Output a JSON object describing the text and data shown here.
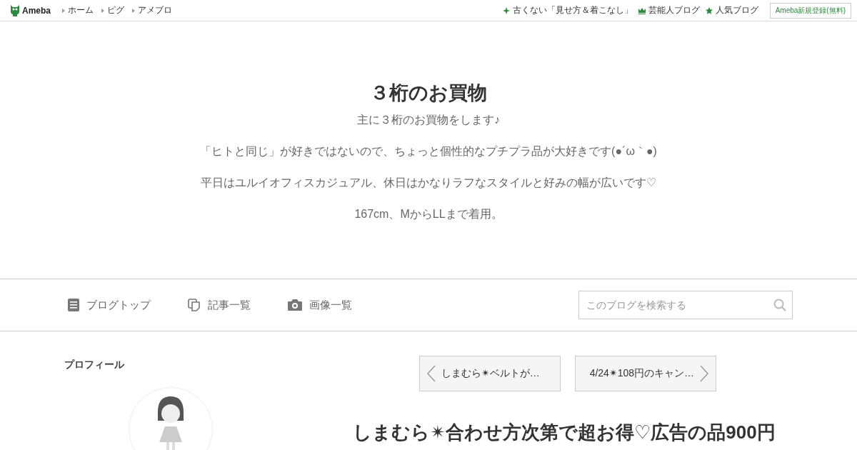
{
  "header": {
    "logo": "Ameba",
    "links": [
      "ホーム",
      "ピグ",
      "アメブロ"
    ],
    "promo_links": [
      {
        "kind": "sparkle",
        "label": "古くない「見せ方＆着こなし」"
      },
      {
        "kind": "crown",
        "label": "芸能人ブログ"
      },
      {
        "kind": "star",
        "label": "人気ブログ"
      }
    ],
    "signup_button": "Ameba新規登録(無料)"
  },
  "blog": {
    "title": "３桁のお買物",
    "description": [
      "主に３桁のお買物をします♪",
      "「ヒトと同じ」が好きではないので、ちょっと個性的なプチプラ品が大好きです(●´ω｀●)",
      "平日はユルイオフィスカジュアル、休日はかなりラフなスタイルと好みの幅が広いです♡",
      "167cm、MからLLまで着用。"
    ]
  },
  "blog_nav": {
    "items": [
      {
        "kind": "document",
        "label": "ブログトップ"
      },
      {
        "kind": "copy",
        "label": "記事一覧"
      },
      {
        "kind": "camera",
        "label": "画像一覧"
      }
    ],
    "search": {
      "placeholder": "このブログを検索する"
    }
  },
  "sidebar": {
    "heading": "プロフィール"
  },
  "article": {
    "pager": [
      {
        "kind": "previous",
        "label": "しまむら✴ベルトが…"
      },
      {
        "kind": "next",
        "label": "4/24✴108円のキャン…"
      }
    ],
    "title": "しまむら✴合わせ方次第で超お得♡広告の品900円"
  }
}
